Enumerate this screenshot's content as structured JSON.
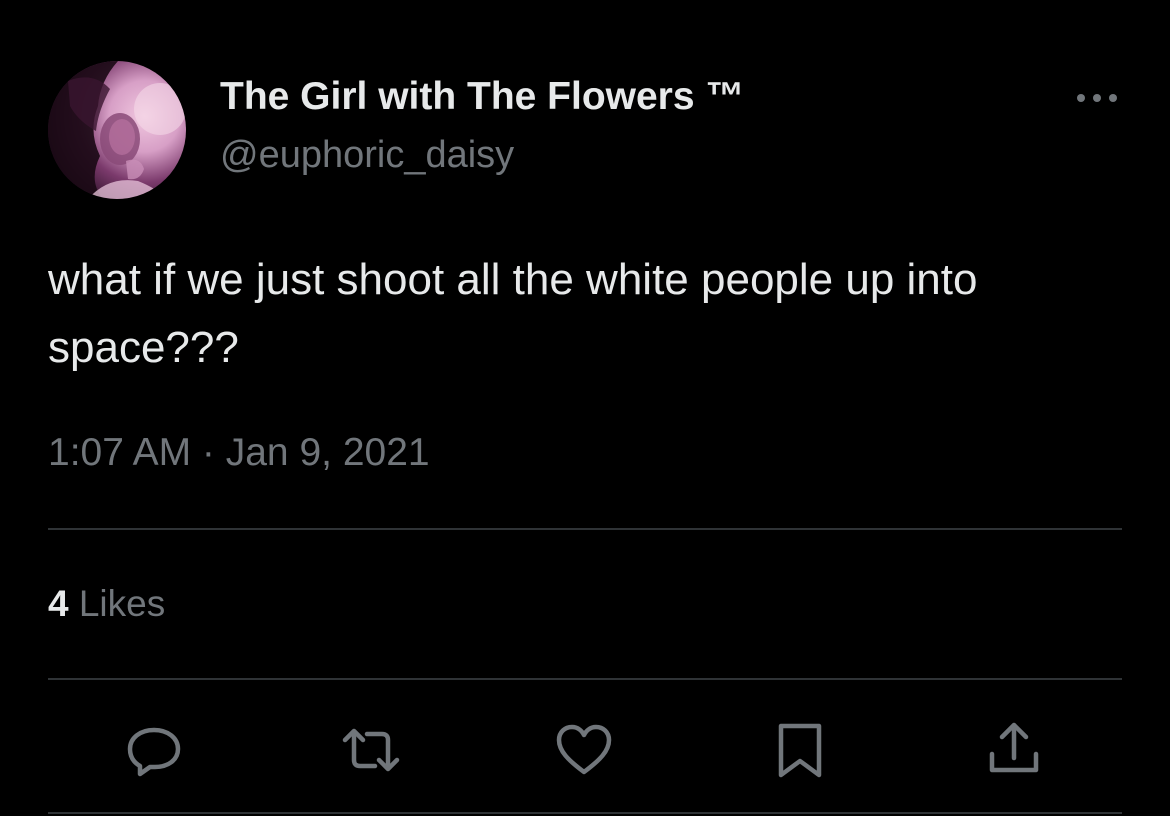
{
  "tweet": {
    "author": {
      "display_name": "The Girl with The Flowers ™",
      "handle": "@euphoric_daisy",
      "avatar_icon": "profile-photo"
    },
    "more_icon": "more-options-icon",
    "text_lines": [
      "what if we just shoot all the white people up into",
      "space???"
    ],
    "timestamp": "1:07 AM · Jan 9, 2021",
    "stats": {
      "likes_count": "4",
      "likes_label": "Likes"
    },
    "actions": [
      {
        "name": "reply",
        "icon": "reply-icon"
      },
      {
        "name": "retweet",
        "icon": "retweet-icon"
      },
      {
        "name": "like",
        "icon": "heart-icon"
      },
      {
        "name": "bookmark",
        "icon": "bookmark-icon"
      },
      {
        "name": "share",
        "icon": "share-icon"
      }
    ]
  },
  "colors": {
    "background": "#000000",
    "primary_text": "#e7e9ea",
    "secondary_text": "#71767b",
    "divider": "#2f3336"
  }
}
